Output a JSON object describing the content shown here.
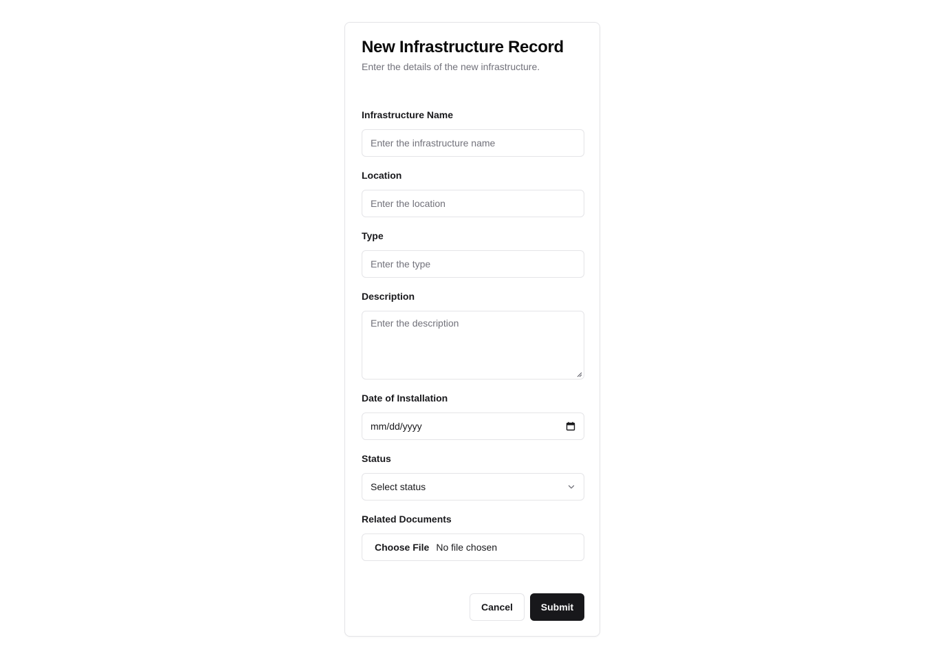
{
  "form": {
    "title": "New Infrastructure Record",
    "subtitle": "Enter the details of the new infrastructure.",
    "fields": {
      "name": {
        "label": "Infrastructure Name",
        "placeholder": "Enter the infrastructure name",
        "value": ""
      },
      "location": {
        "label": "Location",
        "placeholder": "Enter the location",
        "value": ""
      },
      "type": {
        "label": "Type",
        "placeholder": "Enter the type",
        "value": ""
      },
      "description": {
        "label": "Description",
        "placeholder": "Enter the description",
        "value": ""
      },
      "date": {
        "label": "Date of Installation",
        "value": "mm/dd/yyyy",
        "icon": "calendar-icon"
      },
      "status": {
        "label": "Status",
        "selected": "Select status",
        "icon": "chevron-down-icon"
      },
      "documents": {
        "label": "Related Documents",
        "button_label": "Choose File",
        "status_text": "No file chosen"
      }
    },
    "actions": {
      "cancel_label": "Cancel",
      "submit_label": "Submit"
    },
    "colors": {
      "primary": "#18181b",
      "border": "#e4e4e7",
      "muted_text": "#71717a"
    }
  }
}
